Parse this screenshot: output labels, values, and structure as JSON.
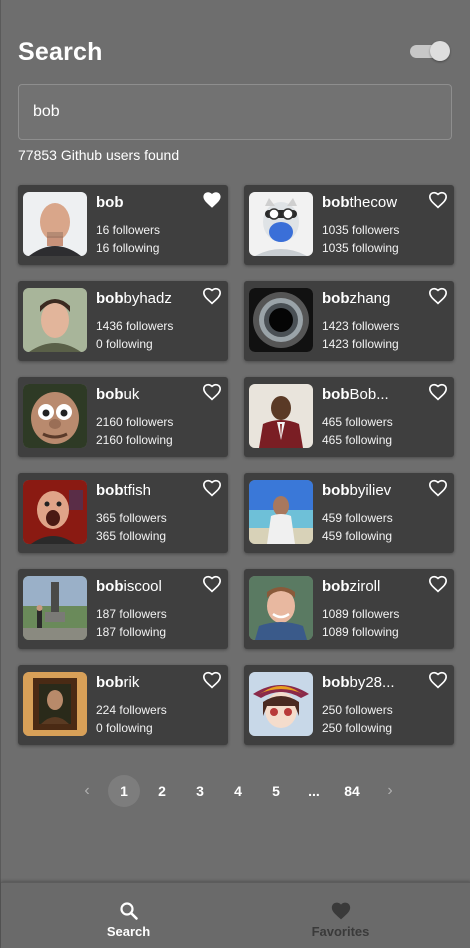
{
  "header": {
    "title": "Search"
  },
  "search": {
    "value": "bob",
    "placeholder": ""
  },
  "results": {
    "found_text": "77853 Github users found"
  },
  "users": [
    {
      "prefix": "bob",
      "suffix": "",
      "followers": "16 followers",
      "following": "16 following",
      "favorited": true,
      "avatar": "bald-man"
    },
    {
      "prefix": "bob",
      "suffix": "thecow",
      "followers": "1035 followers",
      "following": "1035 following",
      "favorited": false,
      "avatar": "masked-cow"
    },
    {
      "prefix": "bob",
      "suffix": "byhadz",
      "followers": "1436 followers",
      "following": "0 following",
      "favorited": false,
      "avatar": "young-man"
    },
    {
      "prefix": "bob",
      "suffix": "zhang",
      "followers": "1423 followers",
      "following": "1423 following",
      "favorited": false,
      "avatar": "black-hole"
    },
    {
      "prefix": "bob",
      "suffix": "uk",
      "followers": "2160 followers",
      "following": "2160 following",
      "favorited": false,
      "avatar": "cartoon-face"
    },
    {
      "prefix": "bob",
      "suffix": "Bob...",
      "followers": "465 followers",
      "following": "465 following",
      "favorited": false,
      "avatar": "man-in-suit"
    },
    {
      "prefix": "bob",
      "suffix": "tfish",
      "followers": "365 followers",
      "following": "365 following",
      "favorited": false,
      "avatar": "shouting-man"
    },
    {
      "prefix": "bob",
      "suffix": "byiliev",
      "followers": "459 followers",
      "following": "459 following",
      "favorited": false,
      "avatar": "beach-man"
    },
    {
      "prefix": "bob",
      "suffix": "iscool",
      "followers": "187 followers",
      "following": "187 following",
      "favorited": false,
      "avatar": "statue-park"
    },
    {
      "prefix": "bob",
      "suffix": "ziroll",
      "followers": "1089 followers",
      "following": "1089 following",
      "favorited": false,
      "avatar": "smiling-man"
    },
    {
      "prefix": "bob",
      "suffix": "rik",
      "followers": "224 followers",
      "following": "0 following",
      "favorited": false,
      "avatar": "framed-portrait"
    },
    {
      "prefix": "bob",
      "suffix": "by28...",
      "followers": "250 followers",
      "following": "250 following",
      "favorited": false,
      "avatar": "anime-girl"
    }
  ],
  "pagination": {
    "prev_icon": "chevron-left-icon",
    "pages": [
      "1",
      "2",
      "3",
      "4",
      "5",
      "...",
      "84"
    ],
    "active": "1",
    "next_icon": "chevron-right-icon"
  },
  "nav": {
    "search_label": "Search",
    "favorites_label": "Favorites"
  },
  "colors": {
    "background": "#6e6e6e",
    "card": "#3f3f3f",
    "fav_inactive": "#3a3a3a"
  }
}
